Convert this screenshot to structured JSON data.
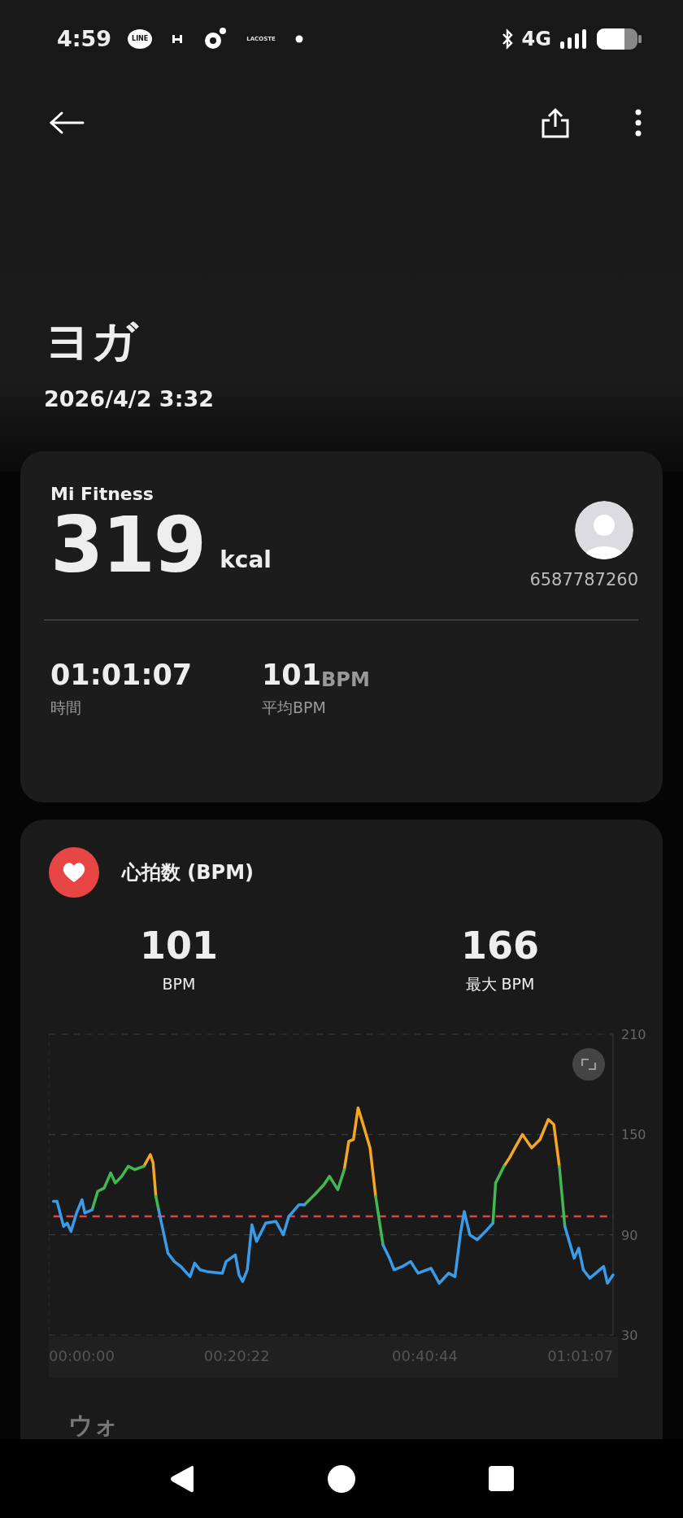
{
  "status_bar": {
    "time": "4:59",
    "notifications": [
      {
        "kind": "bubble",
        "label": "LINE"
      },
      {
        "kind": "mark"
      },
      {
        "kind": "ring"
      },
      {
        "kind": "text",
        "label": "LACOSTE"
      },
      {
        "kind": "dot"
      }
    ],
    "network": "4G"
  },
  "toolbar": {
    "actions": [
      {
        "kind": "share"
      },
      {
        "kind": "more"
      }
    ]
  },
  "workout": {
    "title": "ヨガ",
    "date": "2026/4/2 3:32"
  },
  "summary": {
    "source": "Mi Fitness",
    "calories": "319",
    "calories_unit": "kcal",
    "user_id": "6587787260",
    "stats": [
      {
        "value": "01:01:07",
        "label": "時間"
      },
      {
        "value": "101",
        "unit": "BPM",
        "label": "平均BPM"
      }
    ]
  },
  "heart_rate": {
    "title": "心拍数 (BPM)",
    "stats": [
      {
        "value": "101",
        "label": "BPM"
      },
      {
        "value": "166",
        "label": "最大 BPM"
      }
    ],
    "chart_data": {
      "type": "line",
      "xlim": [
        0,
        61.12
      ],
      "ylim": [
        30,
        210
      ],
      "yticks": [
        30,
        90,
        150,
        210
      ],
      "xticks": [
        {
          "value": 0,
          "label": "00:00:00"
        },
        {
          "value": 20.37,
          "label": "00:20:22"
        },
        {
          "value": 40.73,
          "label": "00:40:44"
        },
        {
          "value": 61.12,
          "label": "01:01:07"
        }
      ],
      "x": [
        0.5,
        0.9,
        1.6,
        2.0,
        2.4,
        3.0,
        3.6,
        3.9,
        4.7,
        5.3,
        6.0,
        6.7,
        7.2,
        7.9,
        8.6,
        9.3,
        10.3,
        11.0,
        11.3,
        11.6,
        11.9,
        12.9,
        13.6,
        14.3,
        15.3,
        15.8,
        16.4,
        17.1,
        18.8,
        19.2,
        20.2,
        20.6,
        21.0,
        21.5,
        22.0,
        22.5,
        23.5,
        24.6,
        25.4,
        26.0,
        27.1,
        27.7,
        28.8,
        29.8,
        30.4,
        31.3,
        32.0,
        32.5,
        33.0,
        33.5,
        34.1,
        34.8,
        35.4,
        36.2,
        36.9,
        37.4,
        38.3,
        39.2,
        40.0,
        41.4,
        42.3,
        43.3,
        44.0,
        44.6,
        45.0,
        45.6,
        46.4,
        47.3,
        48.1,
        48.4,
        49.3,
        49.9,
        50.6,
        51.3,
        52.3,
        53.2,
        54.1,
        54.7,
        55.3,
        55.9,
        56.9,
        57.4,
        57.9,
        58.6,
        60.1,
        60.5,
        61.12
      ],
      "series": [
        {
          "color": "#3a9be8",
          "values": [
            110,
            110,
            95,
            97,
            92,
            103,
            111,
            103,
            105,
            null,
            null,
            null,
            null,
            null,
            null,
            null,
            null,
            null,
            null,
            null,
            105,
            79,
            74,
            71,
            65,
            73,
            69,
            68,
            67,
            74,
            78,
            66,
            62,
            69,
            96,
            86,
            97,
            98,
            90,
            101,
            108,
            108,
            null,
            null,
            null,
            null,
            null,
            null,
            null,
            null,
            null,
            null,
            null,
            84,
            76,
            69,
            71,
            74,
            67,
            70,
            61,
            67,
            65,
            91,
            104,
            90,
            87,
            92,
            97,
            null,
            null,
            null,
            null,
            null,
            null,
            null,
            null,
            null,
            null,
            95,
            76,
            82,
            69,
            64,
            71,
            61,
            66
          ]
        },
        {
          "color": "#3fb950",
          "values": [
            null,
            null,
            null,
            null,
            null,
            null,
            null,
            null,
            105,
            116,
            118,
            127,
            121,
            125,
            131,
            129,
            131,
            null,
            null,
            113,
            105,
            null,
            null,
            null,
            null,
            null,
            null,
            null,
            null,
            null,
            null,
            null,
            null,
            null,
            null,
            null,
            null,
            null,
            null,
            null,
            null,
            108,
            114,
            120,
            125,
            117,
            129,
            null,
            null,
            null,
            null,
            null,
            113,
            84,
            null,
            null,
            null,
            null,
            null,
            null,
            null,
            null,
            null,
            null,
            null,
            null,
            null,
            null,
            97,
            121,
            131,
            null,
            null,
            null,
            null,
            null,
            null,
            null,
            131,
            95,
            null,
            null,
            null,
            null,
            null,
            null,
            null
          ]
        },
        {
          "color": "#f5a623",
          "values": [
            null,
            null,
            null,
            null,
            null,
            null,
            null,
            null,
            null,
            null,
            null,
            null,
            null,
            null,
            null,
            null,
            131,
            138,
            133,
            113,
            null,
            null,
            null,
            null,
            null,
            null,
            null,
            null,
            null,
            null,
            null,
            null,
            null,
            null,
            null,
            null,
            null,
            null,
            null,
            null,
            null,
            null,
            null,
            null,
            null,
            null,
            129,
            146,
            147,
            166,
            155,
            142,
            113,
            null,
            null,
            null,
            null,
            null,
            null,
            null,
            null,
            null,
            null,
            null,
            null,
            null,
            null,
            null,
            null,
            null,
            131,
            136,
            143,
            150,
            142,
            147,
            159,
            156,
            131,
            null,
            null,
            null,
            null,
            null,
            null,
            null,
            null
          ]
        },
        {
          "color": "#e04848",
          "line_style": "dashed",
          "values": [
            101,
            101,
            101,
            101,
            101,
            101,
            101,
            101,
            101,
            101,
            101,
            101,
            101,
            101,
            101,
            101,
            101,
            101,
            101,
            101,
            101,
            101,
            101,
            101,
            101,
            101,
            101,
            101,
            101,
            101,
            101,
            101,
            101,
            101,
            101,
            101,
            101,
            101,
            101,
            101,
            101,
            101,
            101,
            101,
            101,
            101,
            101,
            101,
            101,
            101,
            101,
            101,
            101,
            101,
            101,
            101,
            101,
            101,
            101,
            101,
            101,
            101,
            101,
            101,
            101,
            101,
            101,
            101,
            101,
            101,
            101,
            101,
            101,
            101,
            101,
            101,
            101,
            101,
            101,
            101,
            101,
            101,
            101,
            101,
            101,
            101,
            101
          ]
        }
      ]
    }
  },
  "next_section": {
    "title": "ウォ"
  }
}
